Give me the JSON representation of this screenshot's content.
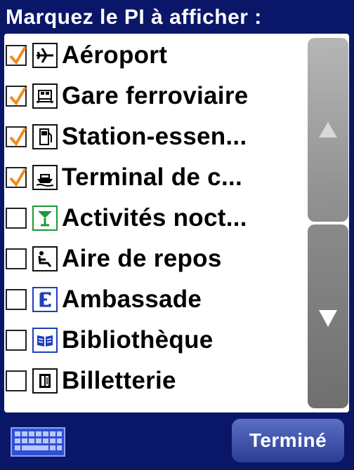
{
  "header": {
    "title": "Marquez le PI à afficher :"
  },
  "items": [
    {
      "label": "Aéroport",
      "checked": true,
      "icon": "airplane-icon"
    },
    {
      "label": "Gare ferroviaire",
      "checked": true,
      "icon": "train-icon"
    },
    {
      "label": "Station-essen...",
      "checked": true,
      "icon": "fuel-pump-icon"
    },
    {
      "label": "Terminal de c...",
      "checked": true,
      "icon": "ferry-icon"
    },
    {
      "label": "Activités noct...",
      "checked": false,
      "icon": "cocktail-glass-icon"
    },
    {
      "label": "Aire de repos",
      "checked": false,
      "icon": "reclining-person-icon"
    },
    {
      "label": "Ambassade",
      "checked": false,
      "icon": "embassy-e-icon"
    },
    {
      "label": "Bibliothèque",
      "checked": false,
      "icon": "open-book-icon"
    },
    {
      "label": "Billetterie",
      "checked": false,
      "icon": "ticket-icon"
    }
  ],
  "footer": {
    "done_label": "Terminé",
    "keyboard_icon": "keyboard-icon"
  },
  "colors": {
    "background": "#0a1768",
    "check": "#f08a1c",
    "button": "#3a4ea8"
  }
}
